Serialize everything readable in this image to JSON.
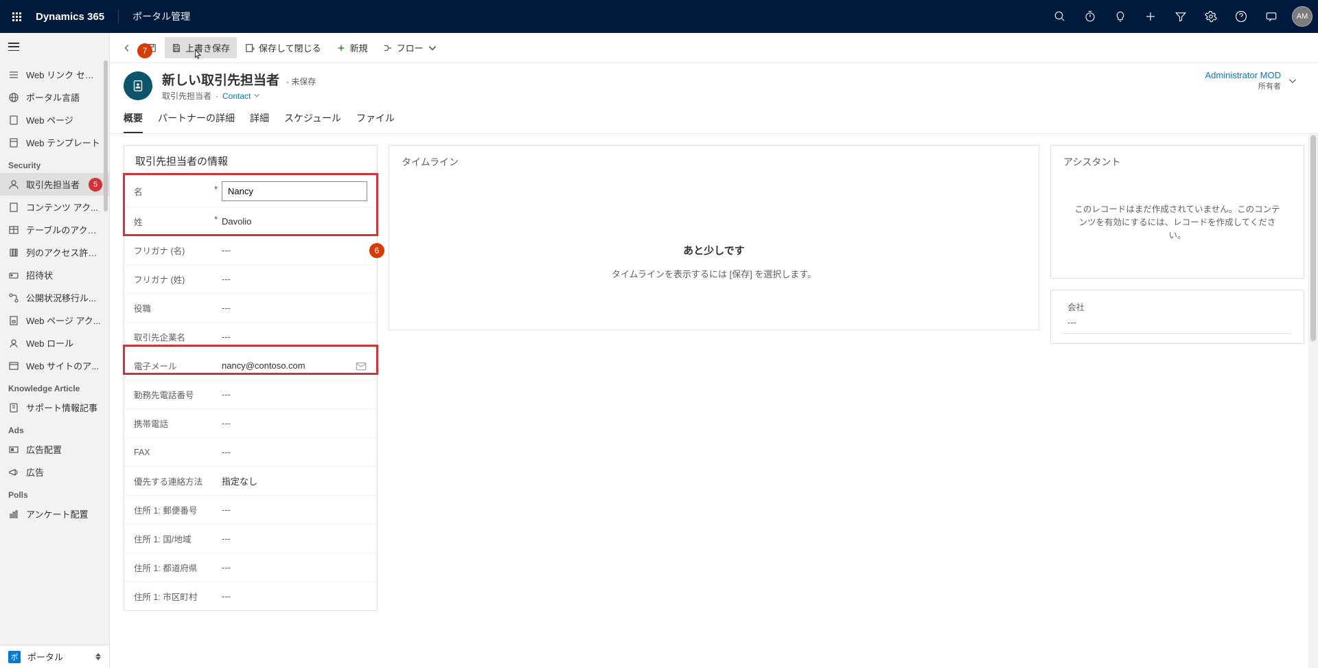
{
  "topbar": {
    "brand": "Dynamics 365",
    "app_name": "ポータル管理",
    "avatar_initials": "AM"
  },
  "leftnav": {
    "items_top": [
      {
        "label": "Web リンク セット"
      },
      {
        "label": "ポータル言語"
      },
      {
        "label": "Web ページ"
      },
      {
        "label": "Web テンプレート"
      }
    ],
    "group_security": "Security",
    "items_security": [
      {
        "label": "取引先担当者",
        "badge": "5",
        "active": true
      },
      {
        "label": "コンテンツ アク..."
      },
      {
        "label": "テーブルのアクセ..."
      },
      {
        "label": "列のアクセス許可..."
      },
      {
        "label": "招待状"
      },
      {
        "label": "公開状況移行ル..."
      },
      {
        "label": "Web ページ アク..."
      },
      {
        "label": "Web ロール"
      },
      {
        "label": "Web サイトのア..."
      }
    ],
    "group_knowledge": "Knowledge Article",
    "items_knowledge": [
      {
        "label": "サポート情報記事"
      }
    ],
    "group_ads": "Ads",
    "items_ads": [
      {
        "label": "広告配置"
      },
      {
        "label": "広告"
      }
    ],
    "group_polls": "Polls",
    "items_polls": [
      {
        "label": "アンケート配置"
      }
    ],
    "bottom": {
      "square": "ポ",
      "label": "ポータル"
    }
  },
  "cmdbar": {
    "save_overwrite": "上書き保存",
    "save_close": "保存して閉じる",
    "new": "新規",
    "flow": "フロー",
    "marker7": "7"
  },
  "record": {
    "title": "新しい取引先担当者",
    "unsaved": "- 未保存",
    "entity": "取引先担当者",
    "form": "Contact",
    "owner_name": "Administrator MOD",
    "owner_label": "所有者"
  },
  "tabs": [
    {
      "label": "概要",
      "active": true
    },
    {
      "label": "パートナーの詳細"
    },
    {
      "label": "詳細"
    },
    {
      "label": "スケジュール"
    },
    {
      "label": "ファイル"
    }
  ],
  "section": {
    "title": "取引先担当者の情報",
    "marker6": "6",
    "fields": {
      "firstname_label": "名",
      "firstname_value": "Nancy",
      "lastname_label": "姓",
      "lastname_value": "Davolio",
      "furigana_first_label": "フリガナ (名)",
      "furigana_last_label": "フリガナ (姓)",
      "jobtitle_label": "役職",
      "company_label": "取引先企業名",
      "email_label": "電子メール",
      "email_value": "nancy@contoso.com",
      "bizphone_label": "勤務先電話番号",
      "mobile_label": "携帯電話",
      "fax_label": "FAX",
      "pref_contact_label": "優先する連絡方法",
      "pref_contact_value": "指定なし",
      "addr_postal_label": "住所 1: 郵便番号",
      "addr_country_label": "住所 1: 国/地域",
      "addr_state_label": "住所 1: 都道府県",
      "addr_city_label": "住所 1: 市区町村",
      "empty": "---"
    }
  },
  "timeline": {
    "title": "タイムライン",
    "big": "あと少しです",
    "small": "タイムラインを表示するには [保存] を選択します。"
  },
  "assistant": {
    "title": "アシスタント",
    "text": "このレコードはまだ作成されていません。このコンテンツを有効にするには、レコードを作成してください。",
    "company_label": "会社",
    "company_value": "---"
  }
}
